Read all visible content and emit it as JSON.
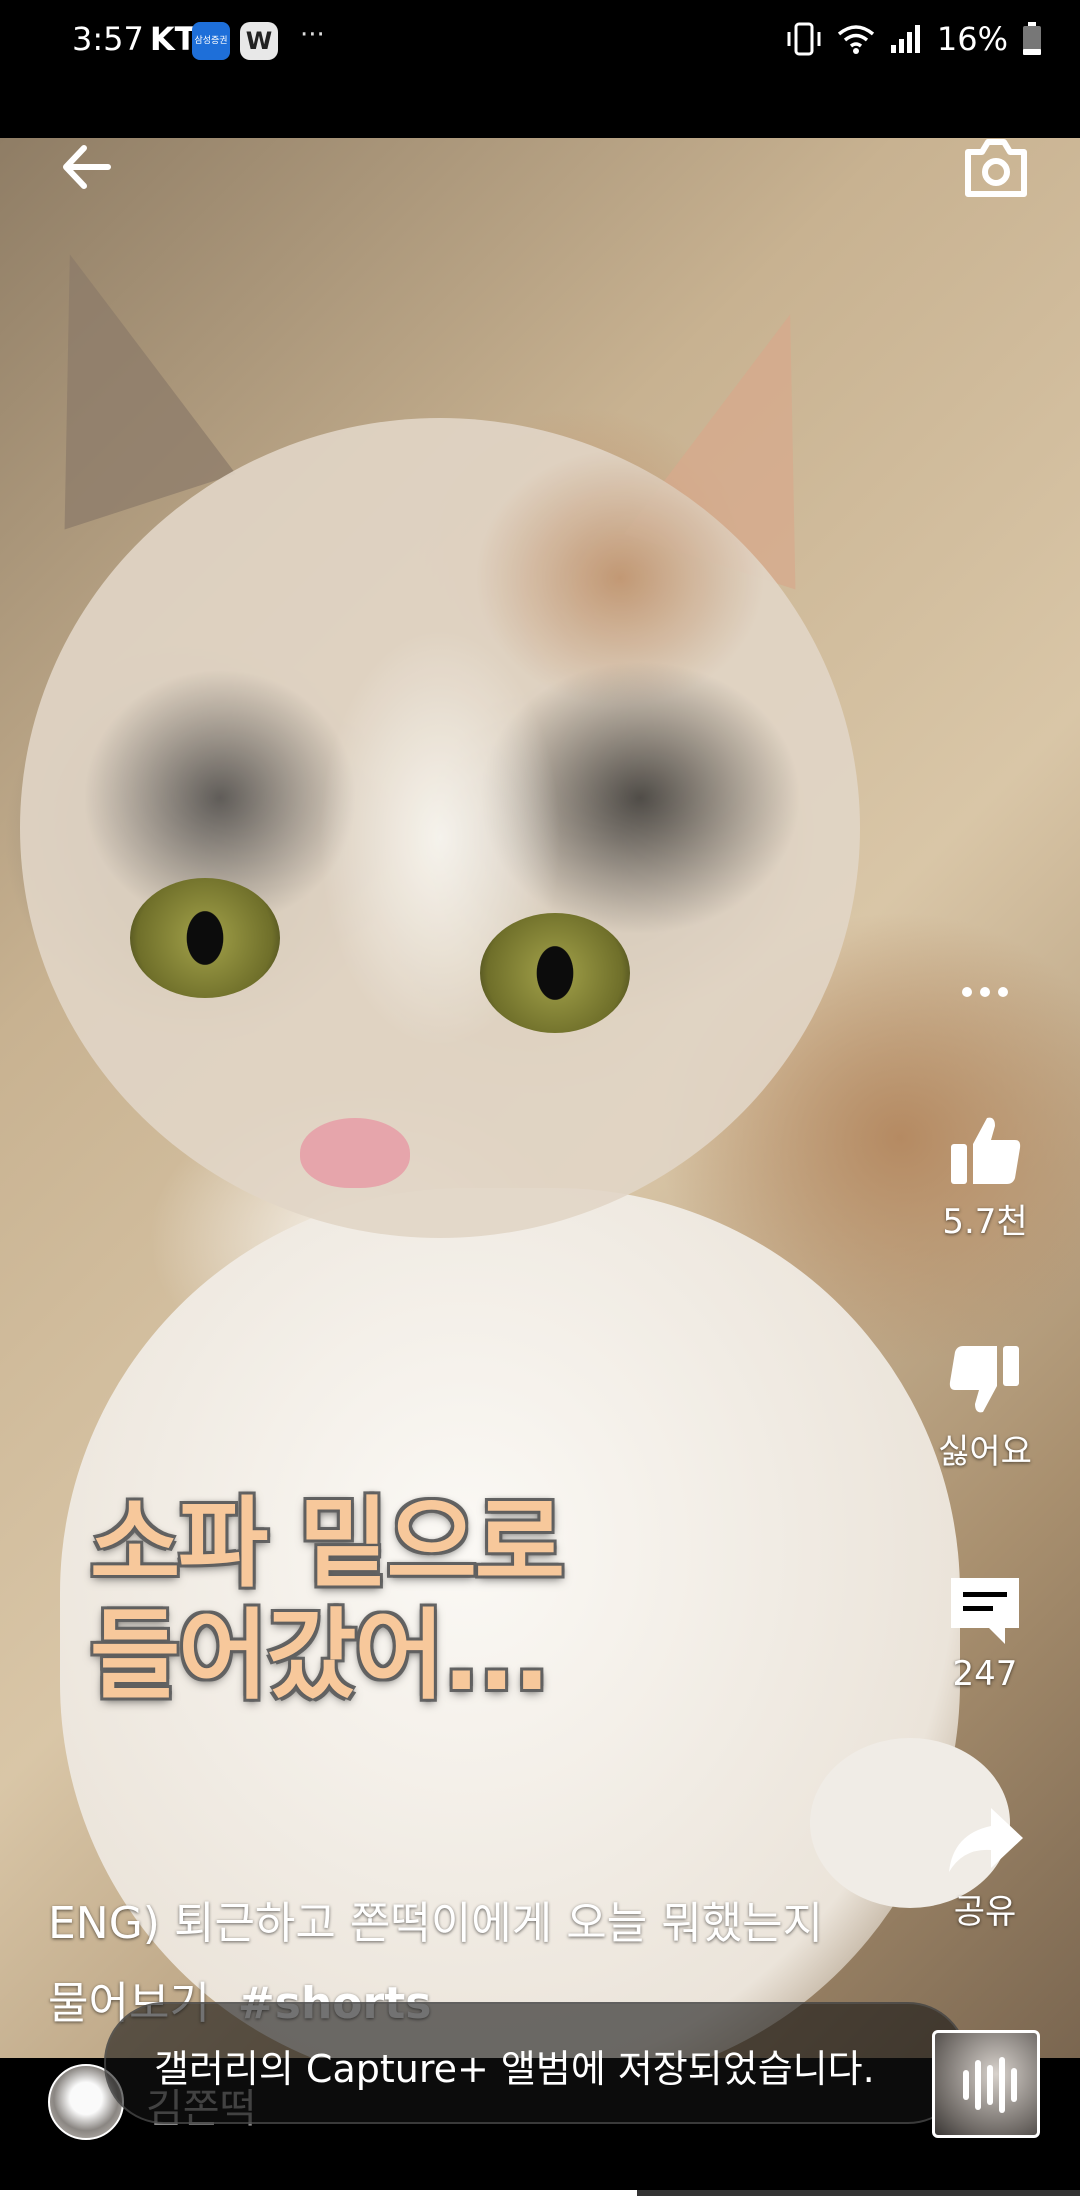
{
  "status_bar": {
    "time": "3:57",
    "carrier": "KT",
    "badge_app": "삼성증권",
    "badge_w": "W",
    "more": "···",
    "battery": "16%"
  },
  "overlay_caption": {
    "line1": "소파 밑으로",
    "line2": "들어갔어..."
  },
  "actions": {
    "like_count": "5.7천",
    "dislike_label": "싫어요",
    "comment_count": "247",
    "share_label": "공유"
  },
  "video": {
    "title": "ENG) 퇴근하고 쫀떡이에게 오늘 뭐했는지 물어보기",
    "hashtag": "#shorts",
    "channel_name": "김쫀떡",
    "progress": 0.59
  },
  "toast": {
    "message": "갤러리의 Capture+ 앨범에 저장되었습니다."
  },
  "icons": {
    "back": "arrow-left-icon",
    "camera": "camera-icon",
    "more": "more-horizontal-icon",
    "like": "thumbs-up-icon",
    "dislike": "thumbs-down-icon",
    "comment": "comment-icon",
    "share": "share-icon"
  }
}
